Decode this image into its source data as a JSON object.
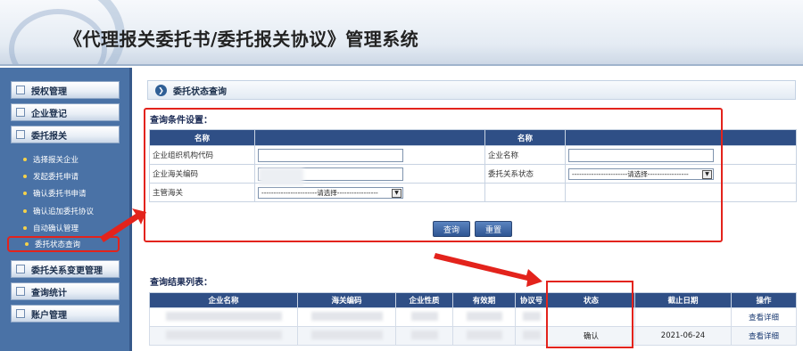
{
  "header": {
    "title": "《代理报关委托书/委托报关协议》管理系统"
  },
  "sidebar": {
    "main_items": [
      {
        "label": "授权管理"
      },
      {
        "label": "企业登记"
      },
      {
        "label": "委托报关"
      }
    ],
    "sub_items": [
      {
        "label": "选择报关企业"
      },
      {
        "label": "发起委托申请"
      },
      {
        "label": "确认委托书申请"
      },
      {
        "label": "确认追加委托协议"
      },
      {
        "label": "自动确认管理"
      },
      {
        "label": "委托状态查询"
      }
    ],
    "lower_items": [
      {
        "label": "委托关系变更管理"
      },
      {
        "label": "查询统计"
      },
      {
        "label": "账户管理"
      }
    ]
  },
  "panel": {
    "title": "委托状态查询"
  },
  "query": {
    "section_title": "查询条件设置：",
    "col_header_left": "名称",
    "col_header_right": "名称",
    "fields": {
      "org_code_label": "企业组织机构代码",
      "org_code_value": "",
      "customs_code_label": "企业海关编码",
      "customs_code_value": "",
      "supervising_customs_label": "主管海关",
      "supervising_customs_value": "-----------------------请选择-----------------",
      "company_name_label": "企业名称",
      "company_name_value": "",
      "relation_status_label": "委托关系状态",
      "relation_status_value": "-----------------------请选择-----------------"
    },
    "search_button": "查询",
    "reset_button": "重置"
  },
  "results": {
    "section_title": "查询结果列表：",
    "columns": [
      "企业名称",
      "海关编码",
      "企业性质",
      "有效期",
      "协议号",
      "状态",
      "截止日期",
      "操作"
    ],
    "rows": [
      {
        "status": "",
        "deadline": "",
        "action": "查看详细"
      },
      {
        "status": "确认",
        "deadline": "2021-06-24",
        "action": "查看详细"
      }
    ]
  },
  "colors": {
    "sidebar_bg": "#4a72a6",
    "table_header_bg": "#2f4f86",
    "annotation_red": "#e3231c"
  }
}
